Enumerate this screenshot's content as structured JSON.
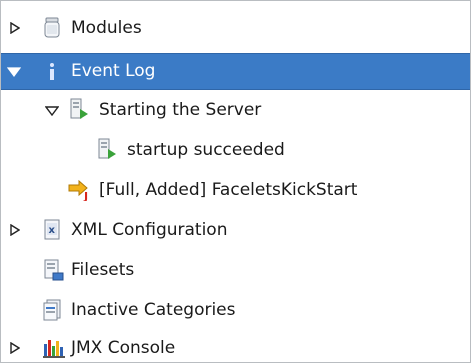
{
  "tree": {
    "modules": {
      "label": "Modules",
      "icon": "jar-icon",
      "expanded": false
    },
    "event_log": {
      "label": "Event Log",
      "icon": "info-icon",
      "expanded": true,
      "selected": true
    },
    "starting_server": {
      "label": "Starting the Server",
      "icon": "server-start-icon",
      "expanded": true
    },
    "startup_succeeded": {
      "label": "startup succeeded",
      "icon": "server-start-icon"
    },
    "faceletskickstart": {
      "label": "[Full, Added] FaceletsKickStart",
      "icon": "deploy-arrow-icon"
    },
    "xml_config": {
      "label": "XML Configuration",
      "icon": "xml-file-icon",
      "expanded": false
    },
    "filesets": {
      "label": "Filesets",
      "icon": "fileset-icon"
    },
    "inactive_categories": {
      "label": "Inactive Categories",
      "icon": "document-icon"
    },
    "jmx_console": {
      "label": "JMX Console",
      "icon": "jmx-bars-icon",
      "expanded": false
    }
  },
  "colors": {
    "selection": "#3b7bc6",
    "text": "#1a1a1a",
    "selected_text": "#ffffff"
  }
}
